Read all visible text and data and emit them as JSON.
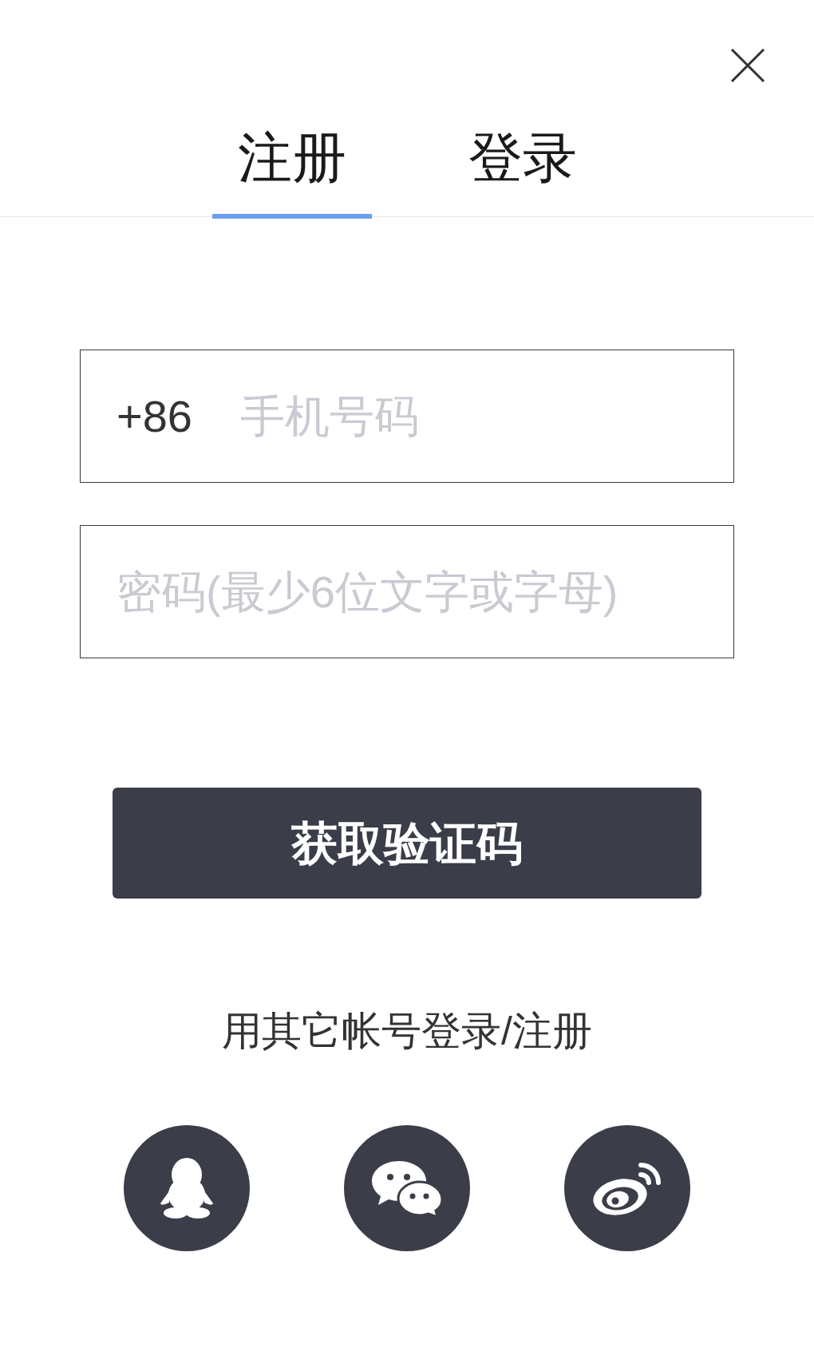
{
  "tabs": [
    {
      "label": "注册",
      "selected": true
    },
    {
      "label": "登录",
      "selected": false
    }
  ],
  "phone_field": {
    "prefix": "+86",
    "placeholder": "手机号码"
  },
  "password_field": {
    "placeholder": "密码(最少6位文字或字母)"
  },
  "submit_button": {
    "label": "获取验证码"
  },
  "other_login": {
    "label": "用其它帐号登录/注册"
  }
}
